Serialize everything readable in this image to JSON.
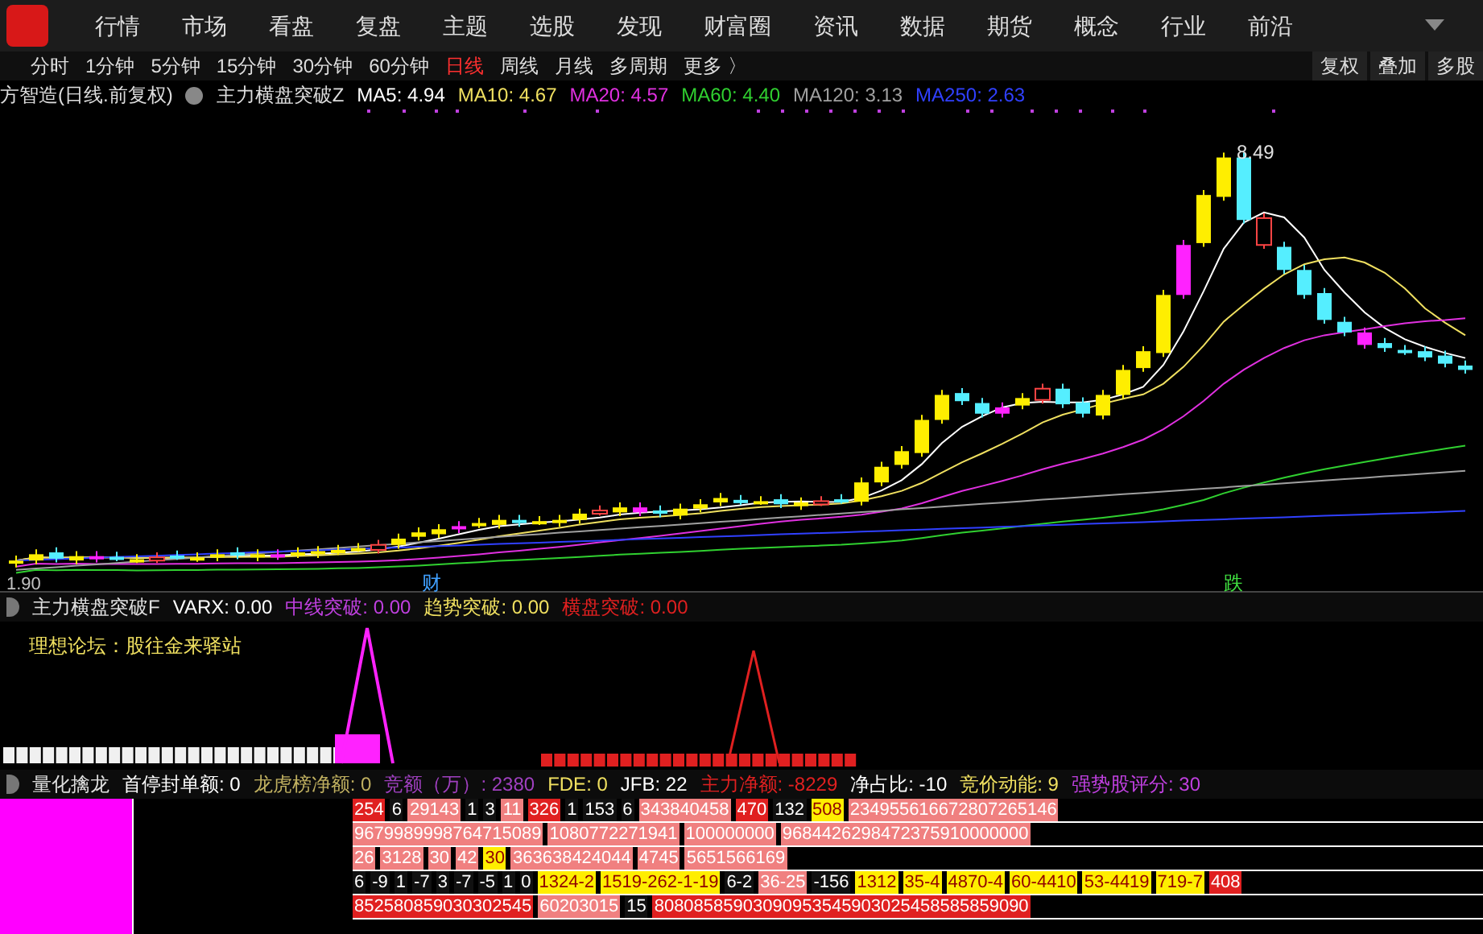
{
  "menu": [
    {
      "label": "行情"
    },
    {
      "label": "市场"
    },
    {
      "label": "看盘"
    },
    {
      "label": "复盘"
    },
    {
      "label": "主题"
    },
    {
      "label": "选股"
    },
    {
      "label": "发现"
    },
    {
      "label": "财富圈"
    },
    {
      "label": "资讯"
    },
    {
      "label": "数据"
    },
    {
      "label": "期货"
    },
    {
      "label": "概念"
    },
    {
      "label": "行业"
    },
    {
      "label": "前沿"
    }
  ],
  "periods": [
    {
      "label": "分时",
      "selected": false
    },
    {
      "label": "1分钟",
      "selected": false
    },
    {
      "label": "5分钟",
      "selected": false
    },
    {
      "label": "15分钟",
      "selected": false
    },
    {
      "label": "30分钟",
      "selected": false
    },
    {
      "label": "60分钟",
      "selected": false
    },
    {
      "label": "日线",
      "selected": true
    },
    {
      "label": "周线",
      "selected": false
    },
    {
      "label": "月线",
      "selected": false
    },
    {
      "label": "多周期",
      "selected": false
    },
    {
      "label": "更多 〉",
      "selected": false
    }
  ],
  "right_buttons": [
    "复权",
    "叠加",
    "多股"
  ],
  "main_chart": {
    "title": "方智造(日线.前复权)",
    "indicator": "主力横盘突破Z",
    "legends": [
      {
        "label": "MA5: 4.94",
        "color": "#ffffff"
      },
      {
        "label": "MA10: 4.67",
        "color": "#f0e060"
      },
      {
        "label": "MA20: 4.57",
        "color": "#e030e0"
      },
      {
        "label": "MA60: 4.40",
        "color": "#30d030"
      },
      {
        "label": "MA120: 3.13",
        "color": "#a0a0a0"
      },
      {
        "label": "MA250: 2.63",
        "color": "#3040ff"
      }
    ],
    "high_label": "8.49",
    "low_label": "1.90",
    "markers": [
      {
        "label": "财",
        "color": "#40a0ff"
      },
      {
        "label": "跌",
        "color": "#40e040"
      }
    ]
  },
  "indicator_panel": {
    "name": "主力横盘突破F",
    "legends": [
      {
        "label": "VARX: 0.00",
        "color": "#ffffff"
      },
      {
        "label": "中线突破: 0.00",
        "color": "#c040e0"
      },
      {
        "label": "趋势突破: 0.00",
        "color": "#f0e060"
      },
      {
        "label": "横盘突破: 0.00",
        "color": "#e02020"
      }
    ],
    "note": "理想论坛：股往金来驿站"
  },
  "bottom_panel": {
    "name": "量化擒龙",
    "legends": [
      {
        "label": "首停封单额: 0",
        "color": "#ffffff"
      },
      {
        "label": "龙虎榜净额: 0",
        "color": "#c0b060"
      },
      {
        "label": "竞额（万）: 2380",
        "color": "#a040c0"
      },
      {
        "label": "FDE: 0",
        "color": "#f0e060"
      },
      {
        "label": "JFB: 22",
        "color": "#ffffff"
      },
      {
        "label": "主力净额: -8229",
        "color": "#e02020"
      },
      {
        "label": "净占比: -10",
        "color": "#ffffff"
      },
      {
        "label": "竞价动能: 9",
        "color": "#f0e060"
      },
      {
        "label": "强势股评分: 30",
        "color": "#c040e0"
      }
    ],
    "strips": [
      {
        "segments": [
          {
            "text": "254",
            "color": "#e02020"
          },
          {
            "text": "6",
            "color": "#111111"
          },
          {
            "text": "29143",
            "color": "#f08080"
          },
          {
            "text": "1",
            "color": "#111111"
          },
          {
            "text": "3",
            "color": "#111111"
          },
          {
            "text": "11",
            "color": "#f08080"
          },
          {
            "text": "326",
            "color": "#e02020"
          },
          {
            "text": "1",
            "color": "#111111"
          },
          {
            "text": "153",
            "color": "#111111"
          },
          {
            "text": "6",
            "color": "#111111"
          },
          {
            "text": "343840458",
            "color": "#f08080"
          },
          {
            "text": "470",
            "color": "#e02020"
          },
          {
            "text": "132",
            "color": "#111111"
          },
          {
            "text": "508",
            "color": "#ffee00"
          },
          {
            "text": "234955616672807265146",
            "color": "#f08080"
          }
        ]
      },
      {
        "segments": [
          {
            "text": "9679989998764715089",
            "color": "#f08080"
          },
          {
            "text": "1080772271941",
            "color": "#f08080"
          },
          {
            "text": "100000000",
            "color": "#f08080"
          },
          {
            "text": "9684426298472375910000000",
            "color": "#f08080"
          }
        ]
      },
      {
        "segments": [
          {
            "text": "26",
            "color": "#f08080"
          },
          {
            "text": "3128",
            "color": "#f08080"
          },
          {
            "text": "30",
            "color": "#f08080"
          },
          {
            "text": "42",
            "color": "#f08080"
          },
          {
            "text": "30",
            "color": "#ffee00"
          },
          {
            "text": "363638424044",
            "color": "#f08080"
          },
          {
            "text": "4745",
            "color": "#f08080"
          },
          {
            "text": "5651566169",
            "color": "#f08080"
          }
        ]
      },
      {
        "segments": [
          {
            "text": "6",
            "color": "#111111"
          },
          {
            "text": "-9",
            "color": "#111111"
          },
          {
            "text": "1",
            "color": "#111111"
          },
          {
            "text": "-7",
            "color": "#111111"
          },
          {
            "text": "3",
            "color": "#111111"
          },
          {
            "text": "-7",
            "color": "#111111"
          },
          {
            "text": "-5",
            "color": "#111111"
          },
          {
            "text": "1",
            "color": "#111111"
          },
          {
            "text": "0",
            "color": "#111111"
          },
          {
            "text": "1324-2",
            "color": "#ffee00"
          },
          {
            "text": "1519-262-1-19",
            "color": "#ffee00"
          },
          {
            "text": "6-2",
            "color": "#111111"
          },
          {
            "text": "36-25",
            "color": "#f08080"
          },
          {
            "text": "-156",
            "color": "#111111"
          },
          {
            "text": "1312",
            "color": "#ffee00"
          },
          {
            "text": "35-4",
            "color": "#ffee00"
          },
          {
            "text": "4870-4",
            "color": "#ffee00"
          },
          {
            "text": "60-4410",
            "color": "#ffee00"
          },
          {
            "text": "53-4419",
            "color": "#ffee00"
          },
          {
            "text": "719-7",
            "color": "#ffee00"
          },
          {
            "text": "408",
            "color": "#e02020"
          }
        ]
      },
      {
        "segments": [
          {
            "text": "852580859030302545",
            "color": "#e02020"
          },
          {
            "text": "60203015",
            "color": "#f08080"
          },
          {
            "text": "15",
            "color": "#111111"
          },
          {
            "text": "80808585903090953545903025458585859090",
            "color": "#e02020"
          }
        ]
      }
    ]
  }
}
